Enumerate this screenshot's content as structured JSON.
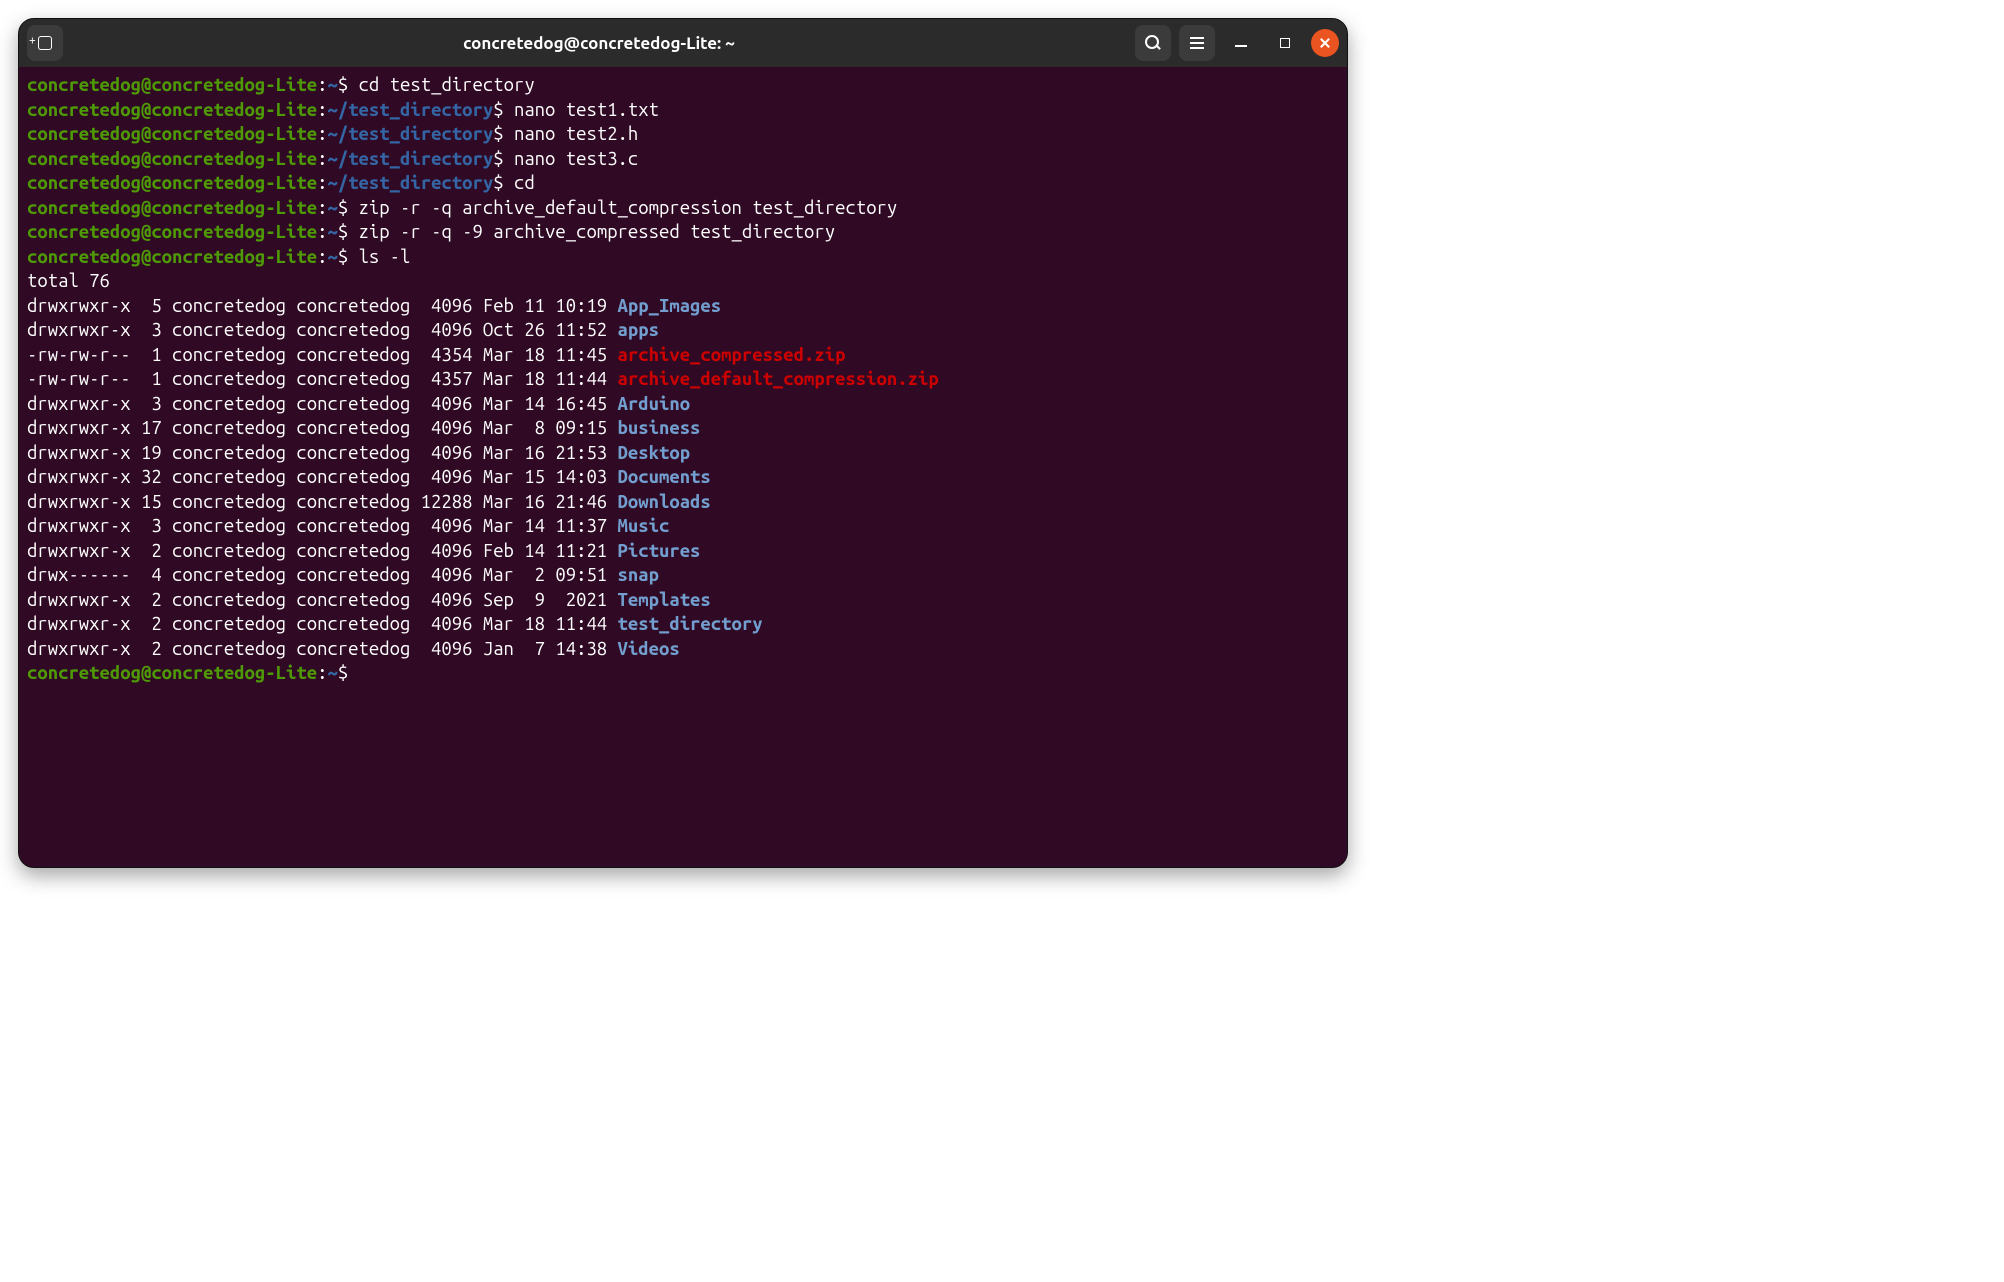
{
  "titlebar": {
    "title": "concretedog@concretedog-Lite: ~",
    "newtab_icon": "new-tab-icon",
    "search_icon": "search-icon",
    "menu_icon": "hamburger-icon",
    "minimize_icon": "minimize-icon",
    "maximize_icon": "maximize-icon",
    "close_icon": "close-icon"
  },
  "colors": {
    "bg": "#300a24",
    "green": "#4e9a06",
    "blue": "#3465a4",
    "blue_dir": "#729fcf",
    "red": "#cc0000",
    "white": "#ffffff"
  },
  "term": {
    "user_host": "concretedog@concretedog-Lite",
    "home_path": "~",
    "sub_path": "~/test_directory",
    "dollar": "$",
    "colon": ":",
    "cmds": [
      {
        "path": "~",
        "cmd": "cd test_directory"
      },
      {
        "path": "~/test_directory",
        "cmd": "nano test1.txt"
      },
      {
        "path": "~/test_directory",
        "cmd": "nano test2.h"
      },
      {
        "path": "~/test_directory",
        "cmd": "nano test3.c"
      },
      {
        "path": "~/test_directory",
        "cmd": "cd"
      },
      {
        "path": "~",
        "cmd": "zip -r -q archive_default_compression test_directory"
      },
      {
        "path": "~",
        "cmd": "zip -r -q -9 archive_compressed test_directory"
      },
      {
        "path": "~",
        "cmd": "ls -l"
      }
    ],
    "total_line": "total 76",
    "ls": [
      {
        "perm": "drwxrwxr-x",
        "links": " 5",
        "owner": "concretedog",
        "group": "concretedog",
        "size": " 4096",
        "date": "Feb 11 10:19",
        "name": "App_Images",
        "type": "dir"
      },
      {
        "perm": "drwxrwxr-x",
        "links": " 3",
        "owner": "concretedog",
        "group": "concretedog",
        "size": " 4096",
        "date": "Oct 26 11:52",
        "name": "apps",
        "type": "dir"
      },
      {
        "perm": "-rw-rw-r--",
        "links": " 1",
        "owner": "concretedog",
        "group": "concretedog",
        "size": " 4354",
        "date": "Mar 18 11:45",
        "name": "archive_compressed.zip",
        "type": "zip"
      },
      {
        "perm": "-rw-rw-r--",
        "links": " 1",
        "owner": "concretedog",
        "group": "concretedog",
        "size": " 4357",
        "date": "Mar 18 11:44",
        "name": "archive_default_compression.zip",
        "type": "zip"
      },
      {
        "perm": "drwxrwxr-x",
        "links": " 3",
        "owner": "concretedog",
        "group": "concretedog",
        "size": " 4096",
        "date": "Mar 14 16:45",
        "name": "Arduino",
        "type": "dir"
      },
      {
        "perm": "drwxrwxr-x",
        "links": "17",
        "owner": "concretedog",
        "group": "concretedog",
        "size": " 4096",
        "date": "Mar  8 09:15",
        "name": "business",
        "type": "dir"
      },
      {
        "perm": "drwxrwxr-x",
        "links": "19",
        "owner": "concretedog",
        "group": "concretedog",
        "size": " 4096",
        "date": "Mar 16 21:53",
        "name": "Desktop",
        "type": "dir"
      },
      {
        "perm": "drwxrwxr-x",
        "links": "32",
        "owner": "concretedog",
        "group": "concretedog",
        "size": " 4096",
        "date": "Mar 15 14:03",
        "name": "Documents",
        "type": "dir"
      },
      {
        "perm": "drwxrwxr-x",
        "links": "15",
        "owner": "concretedog",
        "group": "concretedog",
        "size": "12288",
        "date": "Mar 16 21:46",
        "name": "Downloads",
        "type": "dir"
      },
      {
        "perm": "drwxrwxr-x",
        "links": " 3",
        "owner": "concretedog",
        "group": "concretedog",
        "size": " 4096",
        "date": "Mar 14 11:37",
        "name": "Music",
        "type": "dir"
      },
      {
        "perm": "drwxrwxr-x",
        "links": " 2",
        "owner": "concretedog",
        "group": "concretedog",
        "size": " 4096",
        "date": "Feb 14 11:21",
        "name": "Pictures",
        "type": "dir"
      },
      {
        "perm": "drwx------",
        "links": " 4",
        "owner": "concretedog",
        "group": "concretedog",
        "size": " 4096",
        "date": "Mar  2 09:51",
        "name": "snap",
        "type": "dir"
      },
      {
        "perm": "drwxrwxr-x",
        "links": " 2",
        "owner": "concretedog",
        "group": "concretedog",
        "size": " 4096",
        "date": "Sep  9  2021",
        "name": "Templates",
        "type": "dir"
      },
      {
        "perm": "drwxrwxr-x",
        "links": " 2",
        "owner": "concretedog",
        "group": "concretedog",
        "size": " 4096",
        "date": "Mar 18 11:44",
        "name": "test_directory",
        "type": "dir"
      },
      {
        "perm": "drwxrwxr-x",
        "links": " 2",
        "owner": "concretedog",
        "group": "concretedog",
        "size": " 4096",
        "date": "Jan  7 14:38",
        "name": "Videos",
        "type": "dir"
      }
    ],
    "final_prompt_path": "~"
  }
}
